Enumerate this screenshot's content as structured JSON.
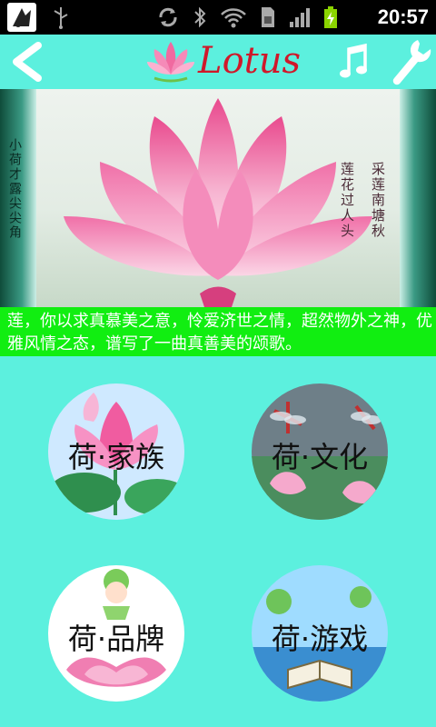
{
  "status_bar": {
    "time": "20:57",
    "icons": [
      "app-icon",
      "usb-icon",
      "sync-icon",
      "bluetooth-icon",
      "wifi-icon",
      "sim-icon",
      "signal-icon",
      "battery-charging-icon"
    ]
  },
  "title_bar": {
    "logo_text": "Lotus",
    "back_icon": "back-icon",
    "music_icon": "music-icon",
    "settings_icon": "wrench-icon"
  },
  "banner": {
    "side_poem": "小荷才露尖尖角",
    "poem_line1": "采莲南塘秋",
    "poem_line2": "莲花过人头"
  },
  "intro_text": "莲，你以求真慕美之意，怜爱济世之情，超然物外之神，优雅风情之态，谱写了一曲真善美的颂歌。",
  "menu": {
    "family": "荷·家族",
    "culture": "荷·文化",
    "brand": "荷·品牌",
    "games": "荷·游戏"
  },
  "colors": {
    "background": "#5cf0de",
    "intro_bar": "#11ee11",
    "logo_red": "#d0182a",
    "status_bar": "#000000"
  }
}
